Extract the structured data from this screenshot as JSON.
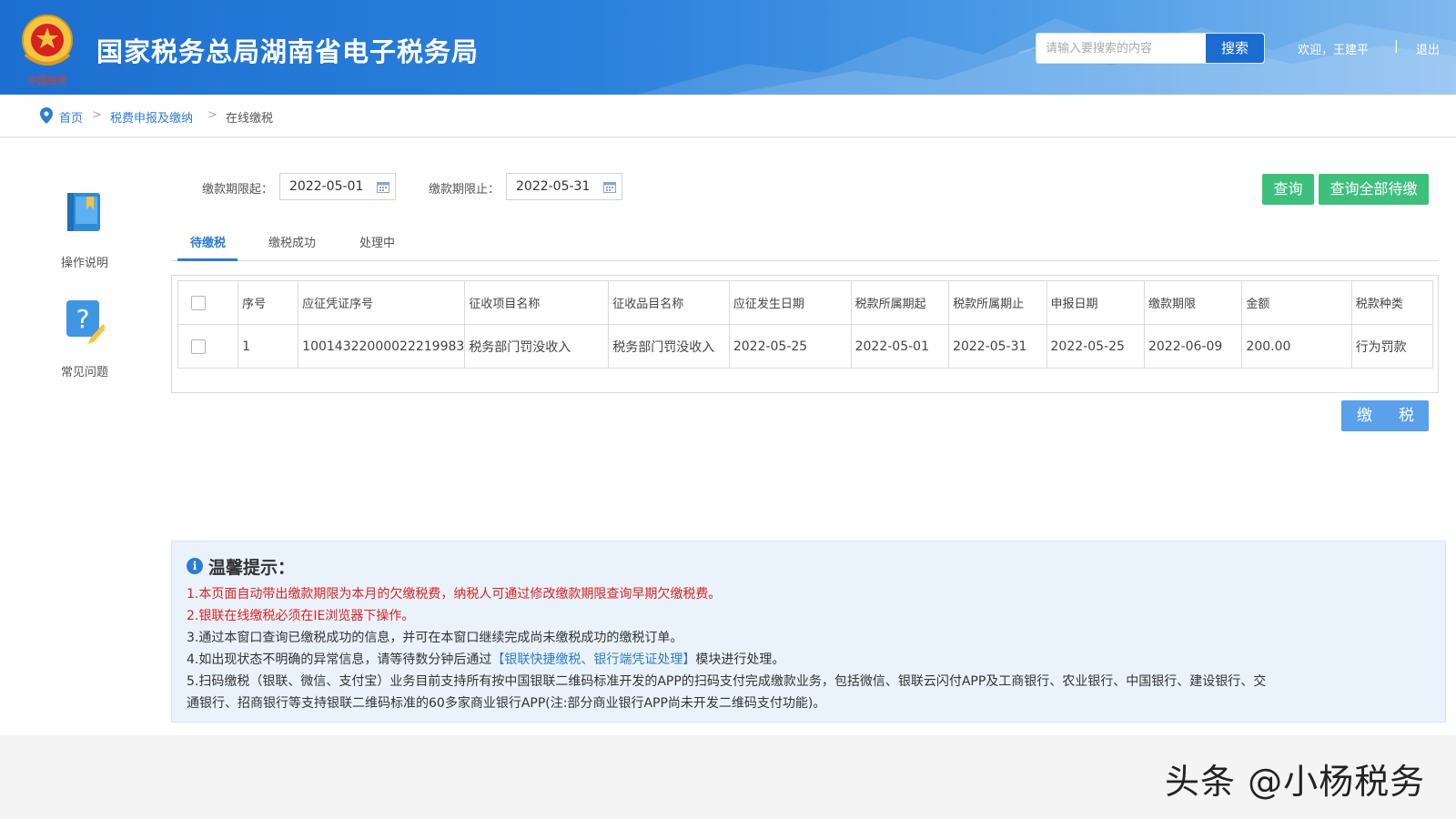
{
  "header": {
    "site_title": "国家税务总局湖南省电子税务局",
    "search_placeholder": "请输入要搜索的内容",
    "search_button": "搜索",
    "welcome": "欢迎，王建平",
    "separator": "|",
    "logout": "退出",
    "colors": {
      "brand": "#1c6fd0",
      "search_button": "#1b6cd0"
    }
  },
  "breadcrumb": {
    "home": "首页",
    "gt": ">",
    "section": "税费申报及缴纳",
    "current": "在线缴税"
  },
  "sidebar": {
    "items": [
      {
        "label": "操作说明",
        "icon": "book-icon"
      },
      {
        "label": "常见问题",
        "icon": "question-edit-icon"
      }
    ]
  },
  "filters": {
    "start_label": "缴款期限起：",
    "start_value": "2022-05-01",
    "end_label": "缴款期限止：",
    "end_value": "2022-05-31"
  },
  "actions": {
    "query": "查询",
    "query_all": "查询全部待缴",
    "pay_chars": [
      "缴",
      "税"
    ],
    "colors": {
      "green": "#3ec07d",
      "blue": "#5aa0ea"
    }
  },
  "tabs": [
    "待缴税",
    "缴税成功",
    "处理中"
  ],
  "table": {
    "headers": [
      "序号",
      "应征凭证序号",
      "征收项目名称",
      "征收品目名称",
      "应征发生日期",
      "税款所属期起",
      "税款所属期止",
      "申报日期",
      "缴款期限",
      "金额",
      "税款种类"
    ],
    "rows": [
      [
        "1",
        "10014322000022219983",
        "税务部门罚没收入",
        "税务部门罚没收入",
        "2022-05-25",
        "2022-05-01",
        "2022-05-31",
        "2022-05-25",
        "2022-06-09",
        "200.00",
        "行为罚款"
      ]
    ]
  },
  "tips": {
    "icon": "i",
    "title": "温馨提示：",
    "line1": "1.本页面自动带出缴款期限为本月的欠缴税费，纳税人可通过修改缴款期限查询早期欠缴税费。",
    "line2": "2.银联在线缴税必须在IE浏览器下操作。",
    "line3": "3.通过本窗口查询已缴税成功的信息，并可在本窗口继续完成尚未缴税成功的缴税订单。",
    "line4_pre": "4.如出现状态不明确的异常信息，请等待数分钟后通过",
    "line4_link": "【银联快捷缴税、银行端凭证处理】",
    "line4_post": "模块进行处理。",
    "line5a": "5.扫码缴税（银联、微信、支付宝）业务目前支持所有按中国银联二维码标准开发的APP的扫码支付完成缴款业务，包括微信、银联云闪付APP及工商银行、农业银行、中国银行、建设银行、交",
    "line5b": "通银行、招商银行等支持银联二维码标准的60多家商业银行APP(注:部分商业银行APP尚未开发二维码支付功能)。"
  },
  "watermark": "头条 @小杨税务"
}
